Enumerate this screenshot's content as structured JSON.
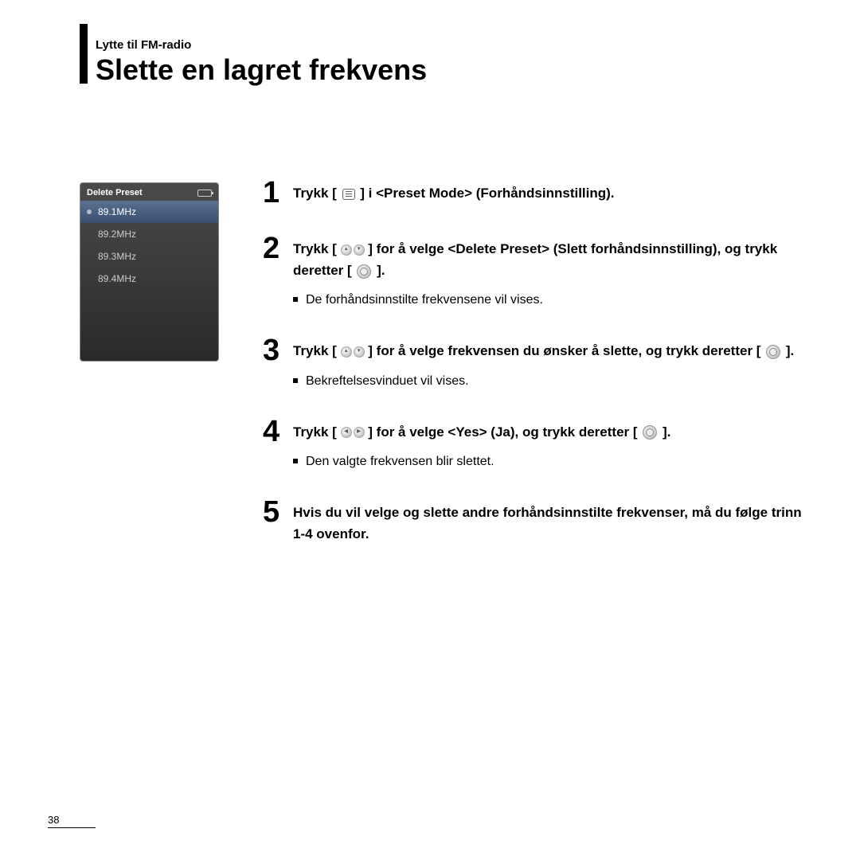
{
  "header": {
    "section": "Lytte til FM-radio",
    "title": "Slette en lagret frekvens"
  },
  "device": {
    "screen_title": "Delete Preset",
    "presets": [
      {
        "freq": "89.1MHz",
        "selected": true
      },
      {
        "freq": "89.2MHz",
        "selected": false
      },
      {
        "freq": "89.3MHz",
        "selected": false
      },
      {
        "freq": "89.4MHz",
        "selected": false
      }
    ]
  },
  "steps": [
    {
      "num": "1",
      "parts": [
        "Trykk [ ",
        "MENU",
        " ] i <Preset Mode> (Forhåndsinnstilling)."
      ],
      "sub": []
    },
    {
      "num": "2",
      "parts": [
        "Trykk [ ",
        "UPDN",
        " ] for å velge <Delete Preset> (Slett forhåndsinnstilling), og trykk deretter [ ",
        "CIRCLE",
        " ]."
      ],
      "sub": [
        "De forhåndsinnstilte frekvensene vil vises."
      ]
    },
    {
      "num": "3",
      "parts": [
        "Trykk [ ",
        "UPDN",
        " ] for å velge frekvensen du ønsker å slette, og trykk deretter [ ",
        "CIRCLE",
        " ]."
      ],
      "sub": [
        "Bekreftelsesvinduet vil vises."
      ]
    },
    {
      "num": "4",
      "parts": [
        "Trykk [ ",
        "LEFTRIGHT",
        " ] for å velge <Yes> (Ja), og trykk deretter [ ",
        "CIRCLE",
        " ]."
      ],
      "sub": [
        "Den valgte frekvensen blir slettet."
      ]
    },
    {
      "num": "5",
      "parts": [
        "Hvis du vil velge og slette andre forhåndsinnstilte frekvenser, må du følge trinn 1-4 ovenfor."
      ],
      "sub": []
    }
  ],
  "page_number": "38"
}
